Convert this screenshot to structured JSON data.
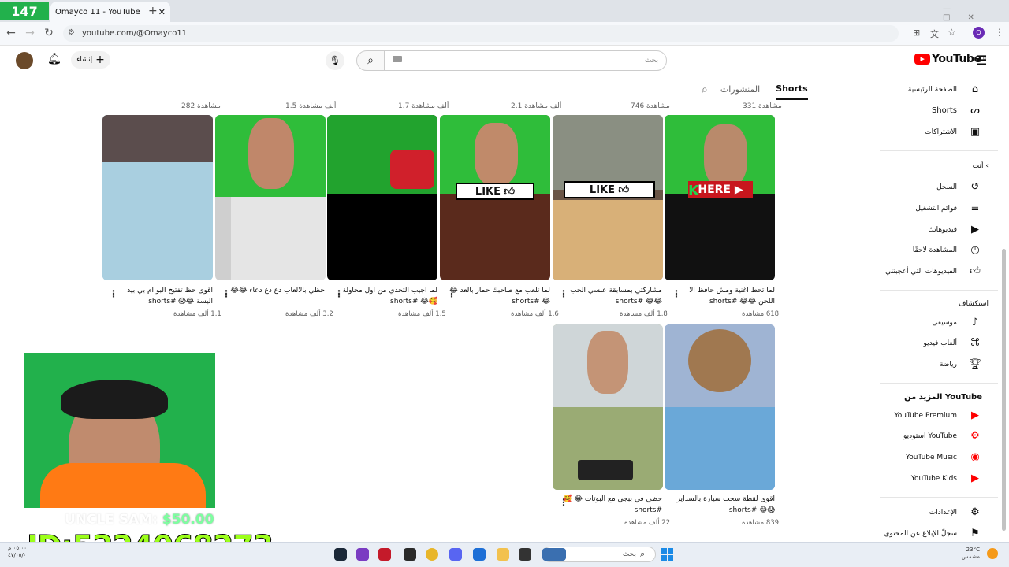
{
  "browser": {
    "tab_title": "Omayco 11 - YouTube",
    "url": "youtube.com/@Omayco11",
    "profile_initial": "O"
  },
  "overlay": {
    "counter": "147",
    "id_text": "ID:5224068273",
    "money_label": "UNCLE SAM:",
    "money_amount": "$50.00"
  },
  "header": {
    "logo_text": "YouTube",
    "logo_sup": "JO",
    "search_placeholder": "بحث",
    "create_label": "إنشاء"
  },
  "channel_tabs": [
    {
      "label": "Shorts",
      "active": true
    },
    {
      "label": "المنشورات",
      "active": false
    }
  ],
  "sidebar": {
    "main": [
      "الصفحة الرئيسية",
      "Shorts",
      "الاشتراكات"
    ],
    "you_heading": "أنت",
    "you": [
      "السجل",
      "قوائم التشغيل",
      "فيديوهاتك",
      "المشاهدة لاحقًا",
      "الفيديوهات التي أعجبتني"
    ],
    "explore_heading": "استكشاف",
    "explore": [
      "موسيقى",
      "ألعاب فيديو",
      "رياضة"
    ],
    "more_heading": "المزيد من YouTube",
    "more": [
      "YouTube Premium",
      "استوديو YouTube",
      "YouTube Music",
      "YouTube Kids"
    ],
    "settings": "الإعدادات",
    "report": "سجلّ الإبلاغ عن المحتوى"
  },
  "top_views": [
    "331 مشاهدة",
    "746 مشاهدة",
    "2.1 ألف مشاهدة",
    "1.7 ألف مشاهدة",
    "1.5 ألف مشاهدة",
    "282 مشاهدة"
  ],
  "shorts_row1": [
    {
      "title": "لما تحط اغنية ومش حافظ الا اللحن 😂😂 #shorts",
      "views": "618 مشاهدة",
      "thumb": "green"
    },
    {
      "title": "مشاركتي بمسابقة عبسي الحب 😂😂 #shorts",
      "views": "1.8 ألف مشاهدة",
      "thumb": "wheel"
    },
    {
      "title": "لما تلعب مع صاحبك حمار بالعد 😂😂 #shorts",
      "views": "1.6 ألف مشاهدة",
      "thumb": "like"
    },
    {
      "title": "لما اجيب التحدي من اول محاولة 🥰😂 #shorts",
      "views": "1.5 ألف مشاهدة",
      "thumb": "black"
    },
    {
      "title": "حظي بالالعاب دع دع دعاء 😂😂",
      "views": "3.2 ألف مشاهدة",
      "thumb": "plane"
    },
    {
      "title": "اقوى حظ تفتيح البو ام بي بيد اليسة 😂😱 #shorts",
      "views": "1.1 ألف مشاهدة",
      "thumb": "ice"
    }
  ],
  "shorts_row2": [
    {
      "title": "اقوى لقطة سحب سيارة بالسداير 😱😂 #shorts",
      "views": "839 مشاهدة",
      "thumb": "cat"
    },
    {
      "title": "حظي في ببجي مع البوتات 😂 🥰 #shorts",
      "views": "22 ألف مشاهدة",
      "thumb": "pubg"
    }
  ],
  "taskbar": {
    "search": "بحث",
    "weather_temp": "23°C",
    "weather_desc": "مشمس",
    "clock_time": "٠٥:٠٠ م",
    "clock_date": "٤٧/٠٥/٠٠"
  },
  "colors": {
    "youtube_red": "#ff0000",
    "green_screen": "#22b14c",
    "id_green": "#9cff1a"
  }
}
